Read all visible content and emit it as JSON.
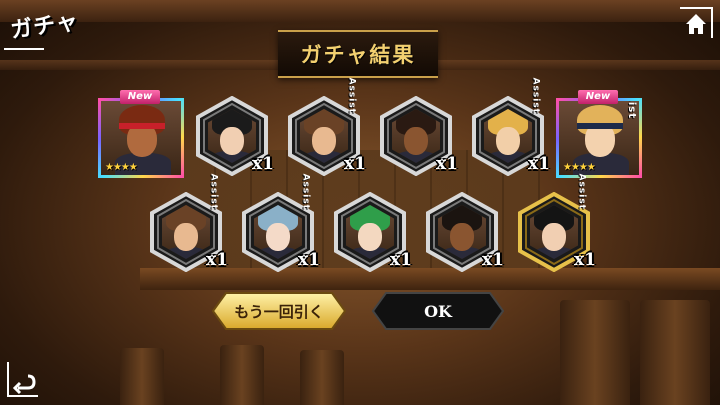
{
  "header": {
    "mode_label": "ガチャ",
    "title": "ガチャ結果",
    "home_icon": "home-icon",
    "back_icon": "back-arrow-icon"
  },
  "results": {
    "row1": [
      {
        "type": "rare",
        "badge": "New",
        "stars": "★★★★",
        "assist": "",
        "hair": "#7a2a12",
        "skin": "#b06a3e",
        "band": "#c8202a"
      },
      {
        "type": "hex",
        "qty": "x1",
        "assist": "",
        "frame": "silver",
        "hair": "#1b1b1b",
        "skin": "#f1cfb2"
      },
      {
        "type": "hex",
        "qty": "x1",
        "assist": "Assist",
        "frame": "silver",
        "hair": "#6a4226",
        "skin": "#e8b990"
      },
      {
        "type": "hex",
        "qty": "x1",
        "assist": "",
        "frame": "silver",
        "hair": "#2a1a12",
        "skin": "#8a5530"
      },
      {
        "type": "hex",
        "qty": "x1",
        "assist": "Assist",
        "frame": "silver",
        "hair": "#e3b14a",
        "skin": "#f2cfa8"
      },
      {
        "type": "rare",
        "badge": "New",
        "stars": "★★★★",
        "assist": "Assist",
        "hair": "#e2b25a",
        "skin": "#f3d2ae",
        "band": "#1d2b4a"
      }
    ],
    "row2": [
      {
        "type": "hex",
        "qty": "x1",
        "assist": "Assist",
        "frame": "silver",
        "hair": "#6a4226",
        "skin": "#e8b990"
      },
      {
        "type": "hex",
        "qty": "x1",
        "assist": "Assist",
        "frame": "silver",
        "hair": "#8ab0c8",
        "skin": "#f4dac8"
      },
      {
        "type": "hex",
        "qty": "x1",
        "assist": "",
        "frame": "silver",
        "hair": "#2f9e4a",
        "skin": "#f3d8c0"
      },
      {
        "type": "hex",
        "qty": "x1",
        "assist": "",
        "frame": "silver",
        "hair": "#1b1410",
        "skin": "#8a5530"
      },
      {
        "type": "hex",
        "qty": "x1",
        "assist": "Assist",
        "frame": "gold",
        "hair": "#141414",
        "skin": "#f1cfb2"
      }
    ]
  },
  "buttons": {
    "again_label": "もう一回引く",
    "ok_label": "OK"
  },
  "colors": {
    "accent_gold": "#f3d070",
    "silver_frame": "#d8d8d8",
    "gold_frame": "#e7c14a"
  }
}
